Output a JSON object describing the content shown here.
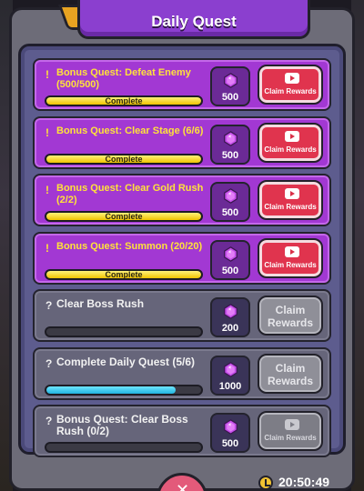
{
  "title": "Daily Quest",
  "colors": {
    "accent": "#a238d3",
    "claim_active": "#e0344e",
    "claim_disabled": "#8f8f98",
    "progress_done": "#f0c400",
    "progress_partial": "#21b4df"
  },
  "quests": [
    {
      "mark": "!",
      "title": "Bonus Quest: Defeat Enemy (500/500)",
      "progress": 1.0,
      "bar_label": "Complete",
      "reward_icon": "purple-gem-icon",
      "reward": "500",
      "claim_small": "Claim Rewards",
      "claim_big": "",
      "state": "ready-video"
    },
    {
      "mark": "!",
      "title": "Bonus Quest: Clear Stage (6/6)",
      "progress": 1.0,
      "bar_label": "Complete",
      "reward_icon": "purple-gem-icon",
      "reward": "500",
      "claim_small": "Claim Rewards",
      "claim_big": "",
      "state": "ready-video"
    },
    {
      "mark": "!",
      "title": "Bonus Quest: Clear Gold Rush (2/2)",
      "progress": 1.0,
      "bar_label": "Complete",
      "reward_icon": "purple-gem-icon",
      "reward": "500",
      "claim_small": "Claim Rewards",
      "claim_big": "",
      "state": "ready-video"
    },
    {
      "mark": "!",
      "title": "Bonus Quest: Summon (20/20)",
      "progress": 1.0,
      "bar_label": "Complete",
      "reward_icon": "purple-gem-icon",
      "reward": "500",
      "claim_small": "Claim Rewards",
      "claim_big": "",
      "state": "ready-video"
    },
    {
      "mark": "?",
      "title": "Clear Boss Rush",
      "progress": 0.0,
      "bar_label": "",
      "reward_icon": "purple-gem-icon",
      "reward": "200",
      "claim_small": "",
      "claim_big": "Claim Rewards",
      "state": "locked"
    },
    {
      "mark": "?",
      "title": "Complete Daily Quest (5/6)",
      "progress": 0.833,
      "bar_label": "",
      "reward_icon": "purple-gem-icon",
      "reward": "1000",
      "claim_small": "",
      "claim_big": "Claim Rewards",
      "state": "locked"
    },
    {
      "mark": "?",
      "title": "Bonus Quest: Clear Boss Rush (0/2)",
      "progress": 0.0,
      "bar_label": "",
      "reward_icon": "purple-gem-icon",
      "reward": "500",
      "claim_small": "Claim Rewards",
      "claim_big": "",
      "state": "locked-video"
    }
  ],
  "footer": {
    "timer": "20:50:49",
    "timer_icon": "clock-icon",
    "close_icon": "close-icon"
  }
}
